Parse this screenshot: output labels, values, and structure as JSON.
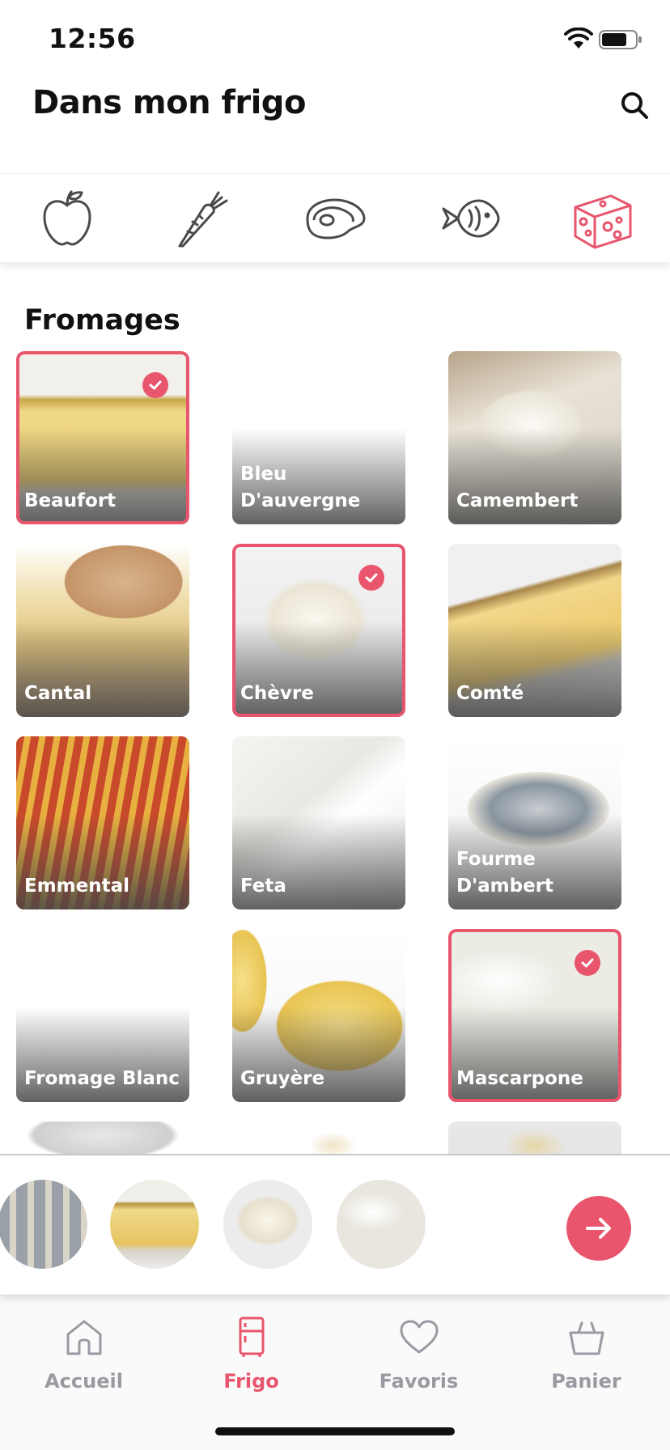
{
  "status_bar": {
    "time": "12:56"
  },
  "header": {
    "title": "Dans mon frigo"
  },
  "categories": [
    {
      "icon": "apple-icon"
    },
    {
      "icon": "carrot-icon"
    },
    {
      "icon": "steak-icon"
    },
    {
      "icon": "fish-icon"
    },
    {
      "icon": "cheese-icon",
      "active": true
    }
  ],
  "section": {
    "title": "Fromages"
  },
  "cheeses": [
    {
      "label": "Beaufort",
      "selected": true
    },
    {
      "label": "Bleu\nD'auvergne",
      "selected": false
    },
    {
      "label": "Camembert",
      "selected": false
    },
    {
      "label": "Cantal",
      "selected": false
    },
    {
      "label": "Chèvre",
      "selected": true
    },
    {
      "label": "Comté",
      "selected": false
    },
    {
      "label": "Emmental",
      "selected": false
    },
    {
      "label": "Feta",
      "selected": false
    },
    {
      "label": "Fourme\nD'ambert",
      "selected": false
    },
    {
      "label": "Fromage Blanc",
      "selected": false
    },
    {
      "label": "Gruyère",
      "selected": false
    },
    {
      "label": "Mascarpone",
      "selected": true
    }
  ],
  "tray": {
    "selected_count": 4
  },
  "tabbar": {
    "tabs": [
      {
        "label": "Accueil",
        "icon": "home-icon"
      },
      {
        "label": "Frigo",
        "icon": "fridge-icon",
        "active": true
      },
      {
        "label": "Favoris",
        "icon": "heart-icon"
      },
      {
        "label": "Panier",
        "icon": "basket-icon"
      }
    ]
  },
  "colors": {
    "accent": "#e8556d",
    "inactive": "#9a9aa2",
    "icon_dark": "#4a4a4a"
  }
}
